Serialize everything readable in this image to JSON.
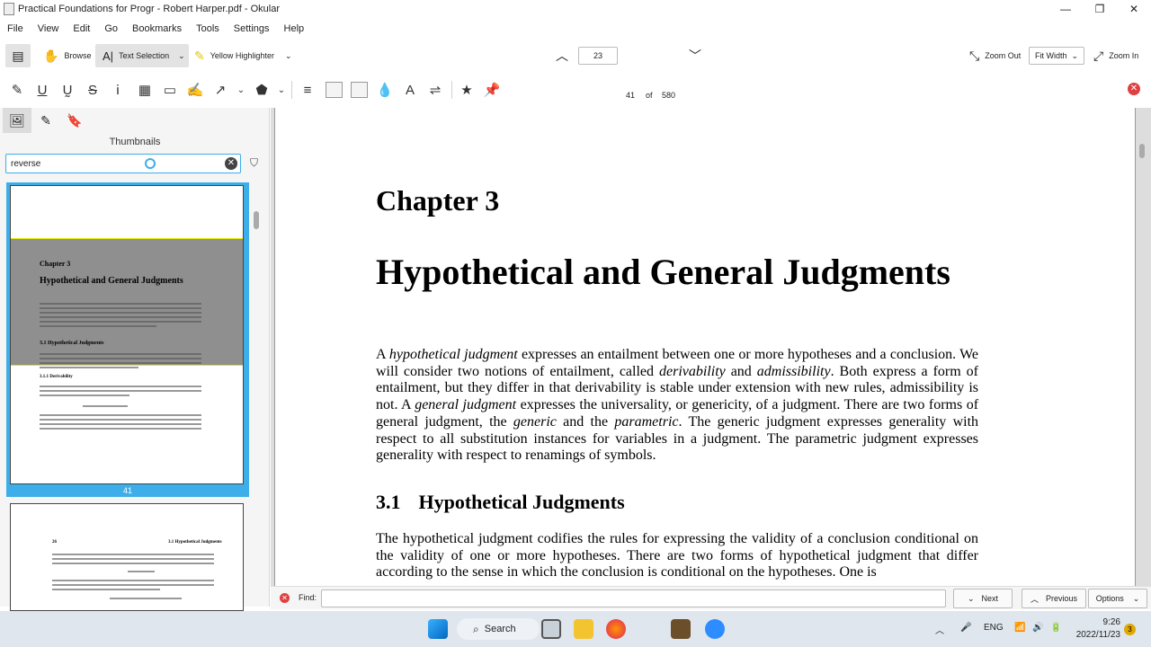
{
  "window": {
    "title": "Practical Foundations for Progr - Robert Harper.pdf - Okular",
    "minimize": "—",
    "maximize": "❐",
    "close": "✕"
  },
  "menu": [
    "File",
    "Edit",
    "View",
    "Go",
    "Bookmarks",
    "Tools",
    "Settings",
    "Help"
  ],
  "toolbar": {
    "browse": "Browse",
    "text_selection": "Text Selection",
    "highlighter": "Yellow Highlighter",
    "page_input": "23",
    "page_label": "41",
    "of": "of",
    "total_pages": "580",
    "zoom_out": "Zoom Out",
    "fit_width": "Fit Width",
    "zoom_in": "Zoom In"
  },
  "sidepanel": {
    "title": "Thumbnails",
    "search_value": "reverse",
    "selected_thumb_label": "41",
    "thumb1": {
      "chapter": "Chapter 3",
      "title": "Hypothetical and General Judgments",
      "section": "3.1   Hypothetical Judgments",
      "subsection": "3.1.1   Derivability"
    },
    "thumb2": {
      "page": "26",
      "header": "3.1 Hypothetical Judgments"
    }
  },
  "document": {
    "chapter_num": "Chapter 3",
    "chapter_title": "Hypothetical and General Judgments",
    "para1": [
      {
        "t": "A "
      },
      {
        "t": "hypothetical judgment",
        "i": true
      },
      {
        "t": " expresses an entailment between one or more hypotheses and a conclusion. We will consider two notions of entailment, called "
      },
      {
        "t": "derivability",
        "i": true
      },
      {
        "t": " and "
      },
      {
        "t": "admissibility",
        "i": true
      },
      {
        "t": ".   Both express a form of entailment, but they differ in that derivability is stable under extension with new rules, admissibility is not.  A "
      },
      {
        "t": "general judgment",
        "i": true
      },
      {
        "t": " expresses the universality, or genericity, of a judgment. There are two forms of general judgment, the "
      },
      {
        "t": "generic",
        "i": true
      },
      {
        "t": " and the "
      },
      {
        "t": "parametric",
        "i": true
      },
      {
        "t": ".  The generic judgment expresses generality with respect to all substitution instances for variables in a judgment.  The parametric judgment expresses generality with respect to renamings of symbols."
      }
    ],
    "section_num": "3.1",
    "section_title": "Hypothetical Judgments",
    "para2": "The hypothetical judgment codifies the rules for expressing the validity of a conclusion conditional on the validity of one or more hypotheses.  There are two forms of hypothetical judgment that differ according to the sense in which the conclusion is conditional on the hypotheses.  One is"
  },
  "findbar": {
    "label": "Find:",
    "next": "Next",
    "previous": "Previous",
    "options": "Options"
  },
  "taskbar": {
    "search": "Search",
    "lang": "ENG",
    "time": "9:26",
    "date": "2022/11/23",
    "notification_count": "3"
  },
  "colors": {
    "accent": "#3daee9",
    "highlight": "#e6e600",
    "close_red": "#e04040"
  }
}
